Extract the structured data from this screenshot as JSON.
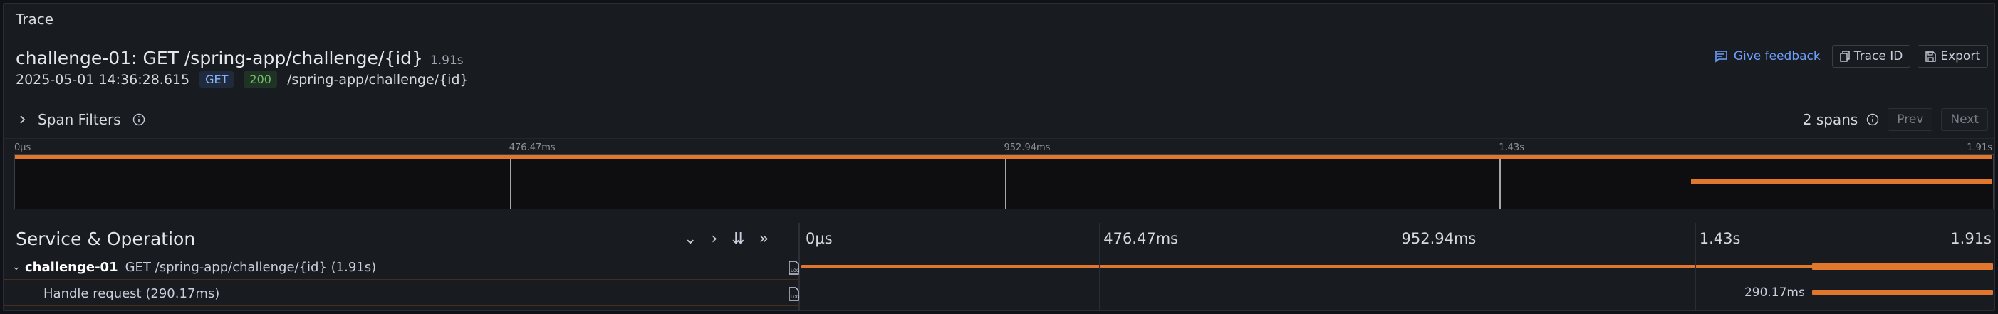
{
  "panel": {
    "title": "Trace"
  },
  "trace": {
    "title": "challenge-01: GET /spring-app/challenge/{id}",
    "duration": "1.91s",
    "timestamp": "2025-05-01 14:36:28.615",
    "method": "GET",
    "status": "200",
    "url": "/spring-app/challenge/{id}"
  },
  "actions": {
    "feedback": "Give feedback",
    "trace_id": "Trace ID",
    "export": "Export"
  },
  "filters": {
    "label": "Span Filters",
    "spans_count": "2 spans",
    "prev": "Prev",
    "next": "Next"
  },
  "minimap": {
    "ticks": [
      "0µs",
      "476.47ms",
      "952.94ms",
      "1.43s",
      "1.91s"
    ]
  },
  "timeline": {
    "header": "Service & Operation",
    "ticks": [
      "0µs",
      "476.47ms",
      "952.94ms",
      "1.43s",
      "1.91s"
    ],
    "total_ms": 1910,
    "spans": [
      {
        "service": "challenge-01",
        "operation": "GET /spring-app/challenge/{id} (1.91s)",
        "start_ms": 0,
        "duration_ms": 1910
      },
      {
        "service": "",
        "operation": "Handle request (290.17ms)",
        "start_ms": 1619.83,
        "duration_ms": 290.17,
        "duration_label": "290.17ms"
      }
    ]
  },
  "colors": {
    "span": "#e0772d",
    "accent": "#6e9fff"
  }
}
